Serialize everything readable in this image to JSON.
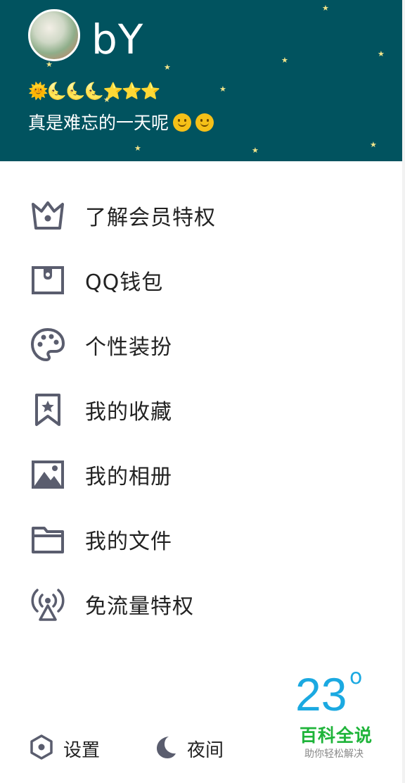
{
  "profile": {
    "name": "bY",
    "level_icons": "🌞🌜🌜🌜⭐⭐⭐",
    "signature": "真是难忘的一天呢"
  },
  "menu": {
    "items": [
      {
        "label": "了解会员特权",
        "icon": "crown-icon"
      },
      {
        "label": "QQ钱包",
        "icon": "wallet-icon"
      },
      {
        "label": "个性装扮",
        "icon": "palette-icon"
      },
      {
        "label": "我的收藏",
        "icon": "bookmark-star-icon"
      },
      {
        "label": "我的相册",
        "icon": "photo-album-icon"
      },
      {
        "label": "我的文件",
        "icon": "folder-icon"
      },
      {
        "label": "免流量特权",
        "icon": "signal-tower-icon"
      }
    ]
  },
  "footer": {
    "settings_label": "设置",
    "night_label": "夜间",
    "temperature": "23",
    "degree_symbol": "o"
  },
  "watermark": {
    "title": "百科全说",
    "subtitle": "助你轻松解决"
  },
  "colors": {
    "header_bg": "#01535f",
    "icon_color": "#5a5d6e",
    "temperature_color": "#1ba9e1",
    "watermark_green": "#1fb43a"
  }
}
